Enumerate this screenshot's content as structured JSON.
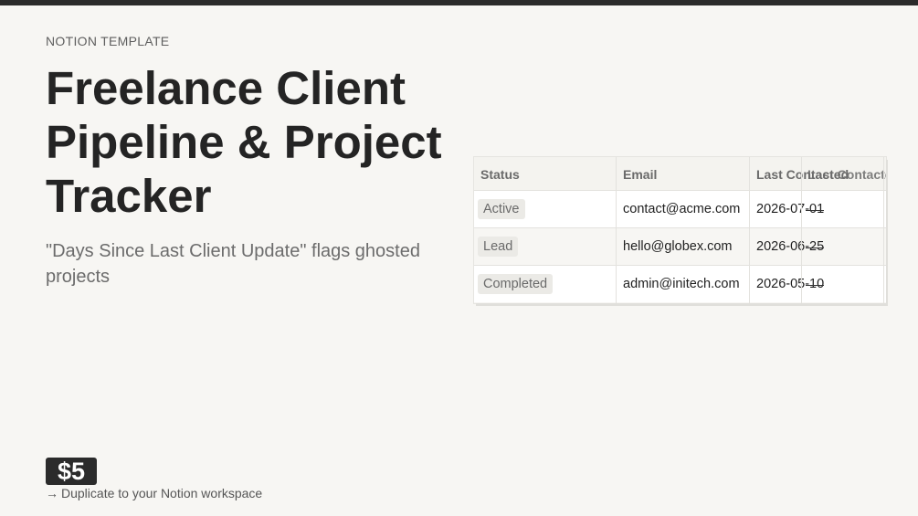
{
  "hero": {
    "eyebrow": "NOTION TEMPLATE",
    "title": "Freelance Client Pipeline & Project Tracker",
    "subtitle": "\"Days Since Last Client Update\" flags ghosted projects",
    "price": "$5",
    "cta_arrow": "→",
    "cta_text": "Duplicate to your Notion workspace"
  },
  "table": {
    "headers": [
      "Status",
      "Email",
      "Last Contacted",
      "Last Contacted"
    ],
    "rows": [
      {
        "status": "Active",
        "email": "contact@acme.com",
        "date": "2026-07-01"
      },
      {
        "status": "Lead",
        "email": "hello@globex.com",
        "date": "2026-06-25"
      },
      {
        "status": "Completed",
        "email": "admin@initech.com",
        "date": "2026-05-10"
      }
    ]
  }
}
